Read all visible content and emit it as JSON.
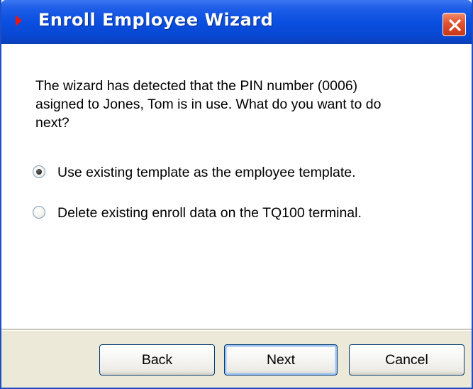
{
  "window": {
    "title": "Enroll Employee Wizard",
    "close_icon": "close-x-icon"
  },
  "message": "The wizard has detected that the PIN number (0006) asigned to Jones, Tom is in use. What do you want to do next?",
  "options": [
    {
      "label": "Use existing template as the employee template.",
      "selected": true
    },
    {
      "label": "Delete existing enroll data on the TQ100 terminal.",
      "selected": false
    }
  ],
  "buttons": {
    "back": "Back",
    "next": "Next",
    "cancel": "Cancel"
  },
  "colors": {
    "titlebar": "#0a4fe0",
    "close_button": "#e2512f",
    "dialog_face": "#ece9d8",
    "title_marker": "#e51818"
  }
}
